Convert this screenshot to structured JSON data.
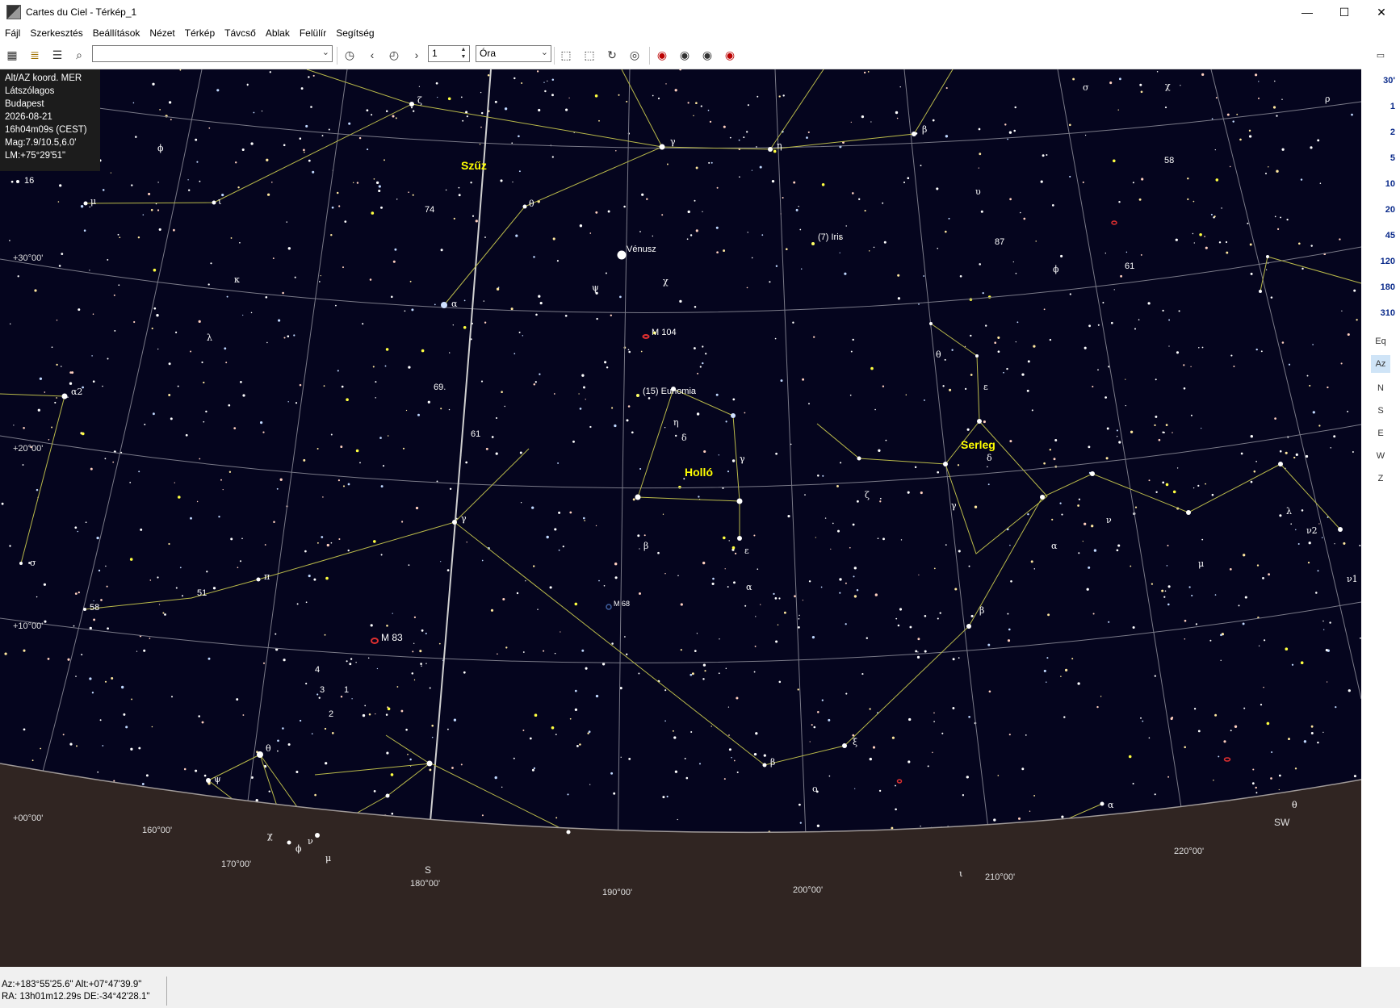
{
  "window": {
    "title": "Cartes du Ciel - Térkép_1",
    "minimize_glyph": "—",
    "maximize_glyph": "☐",
    "close_glyph": "✕"
  },
  "menu": [
    "Fájl",
    "Szerkesztés",
    "Beállítások",
    "Nézet",
    "Térkép",
    "Távcső",
    "Ablak",
    "Felülír",
    "Segítség"
  ],
  "toolbar": {
    "search_value": "",
    "step_value": "1",
    "step_unit": "Óra"
  },
  "info": {
    "lines": [
      "Alt/AZ koord. MER",
      "Látszólagos",
      "Budapest",
      "2026-08-21",
      "16h04m09s (CEST)",
      "Mag:7.9/10.5,6.0'",
      "LM:+75°29'51\""
    ]
  },
  "fov_buttons": [
    "30'",
    "1",
    "2",
    "5",
    "10",
    "20",
    "45",
    "120",
    "180",
    "310"
  ],
  "side_buttons": [
    "Eq",
    "Az",
    "N",
    "S",
    "E",
    "W",
    "Z"
  ],
  "sky": {
    "constellations": [
      "Szűz",
      "Holló",
      "Serleg"
    ],
    "objects": [
      "Vénusz",
      "(7) Iris",
      "(15) Eunomia",
      "M 104",
      "M 68",
      "M 83"
    ],
    "ra_labels": [
      "160°00'",
      "170°00'",
      "180°00'",
      "190°00'",
      "200°00'",
      "210°00'",
      "220°00'"
    ],
    "dec_labels": [
      "+30°00'",
      "+20°00'",
      "+10°00'",
      "+00°00'"
    ],
    "cardinal": [
      "S",
      "SW"
    ],
    "star_labels": {
      "zeta_vir": "ζ",
      "gamma_vir": "γ",
      "eta_vir": "η",
      "beta_vir": "β",
      "iota": "ι",
      "mu": "μ",
      "n16": "16",
      "n74": "74",
      "theta_vir": "θ",
      "alpha_vir": "α",
      "kappa": "κ",
      "lambda": "λ",
      "alpha2": "α2",
      "n69": "69",
      "n61": "61",
      "gamma_hya": "γ",
      "pi": "π",
      "n51": "51",
      "n58": "58",
      "sigma_l": "σ",
      "phi_l": "ϕ",
      "chi_vir": "χ",
      "psi_vir": "ψ",
      "eta_crv": "η",
      "delta_crv": "δ",
      "gamma_crv": "γ",
      "beta_crv": "β",
      "eps_crv": "ε",
      "alpha_crv": "α",
      "theta_crt": "θ",
      "eps_crt": "ε",
      "delta_crt": "δ",
      "gamma_crt": "γ",
      "zeta_crt": "ζ",
      "alpha_crt": "α",
      "beta_crt": "β",
      "nu": "ν",
      "mu_r": "μ",
      "lambda_r": "λ",
      "nu2": "ν2",
      "nu1": "ν1",
      "sigma_r": "σ",
      "chi_r": "χ",
      "rho": "ρ",
      "beta_top": "β",
      "n58_r": "58",
      "upsilon": "υ",
      "n87": "87",
      "phi_r": "ϕ",
      "n61_r": "61",
      "theta_b": "θ",
      "psi_b": "ψ",
      "chi_b": "χ",
      "phi_b": "ϕ",
      "nu_b": "ν",
      "mu_b": "μ",
      "n4": "4",
      "n3": "3",
      "n1": "1",
      "n2": "2",
      "beta_b": "β",
      "xi": "ξ",
      "omicron": "ο",
      "alpha_b": "α",
      "theta_br": "θ",
      "iota_b": "ι"
    }
  },
  "status": {
    "line1": "Az:+183°55'25.6\" Alt:+07°47'39.9\"",
    "line2": "RA: 13h01m12.29s DE:-34°42'28.1\""
  }
}
